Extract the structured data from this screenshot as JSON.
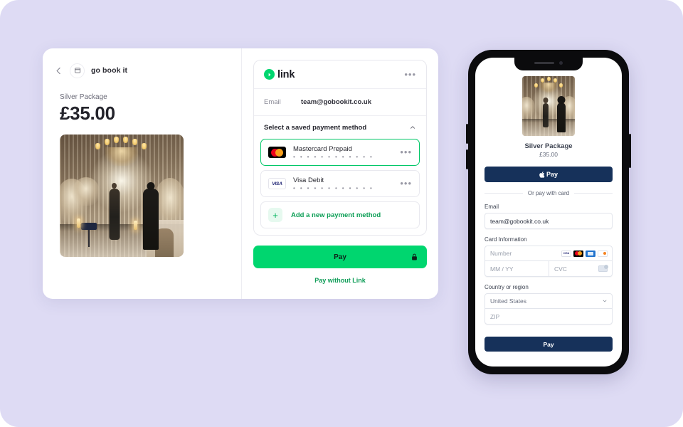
{
  "background_color": "#dedbf4",
  "checkout": {
    "merchant": {
      "name": "go book it",
      "back_icon": "back-arrow-icon",
      "avatar_icon": "browser-window-icon"
    },
    "product": {
      "label": "Silver Package",
      "price": "£35.00",
      "image_alt": "elegant-event-venue-photo"
    },
    "link_panel": {
      "brand_name": "link",
      "brand_color": "#00d66f",
      "menu_icon": "more-options-icon",
      "email_label": "Email",
      "email_value": "team@gobookit.co.uk",
      "saved_methods_title": "Select a saved payment method",
      "collapse_icon": "chevron-up-icon",
      "methods": [
        {
          "brand": "mastercard",
          "name": "Mastercard Prepaid",
          "mask": "• • • • • • • • • • • •",
          "selected": true,
          "menu_icon": "more-options-icon"
        },
        {
          "brand": "visa",
          "brand_label": "VISA",
          "name": "Visa Debit",
          "mask": "• • • • • • • • • • • •",
          "selected": false,
          "menu_icon": "more-options-icon"
        }
      ],
      "add_method_label": "Add a new payment method",
      "add_method_icon": "plus-icon",
      "pay_button_label": "Pay",
      "pay_lock_icon": "lock-icon",
      "pay_without_link_label": "Pay without Link"
    }
  },
  "phone": {
    "product": {
      "title": "Silver Package",
      "price": "£35.00",
      "image_alt": "elegant-event-venue-photo"
    },
    "apple_pay_label": "Pay",
    "apple_pay_icon": "apple-logo-icon",
    "or_pay_with_card": "Or pay with card",
    "email_label": "Email",
    "email_value": "team@gobookit.co.uk",
    "card_information_label": "Card Information",
    "card_number_placeholder": "Number",
    "card_brands": [
      "visa",
      "mastercard",
      "amex",
      "discover"
    ],
    "card_expiry_placeholder": "MM / YY",
    "card_cvc_placeholder": "CVC",
    "cvc_hint_icon": "cvc-card-icon",
    "country_label": "Country or region",
    "country_value": "United States",
    "country_chevron_icon": "chevron-down-icon",
    "zip_placeholder": "ZIP",
    "pay_button_label": "Pay"
  }
}
